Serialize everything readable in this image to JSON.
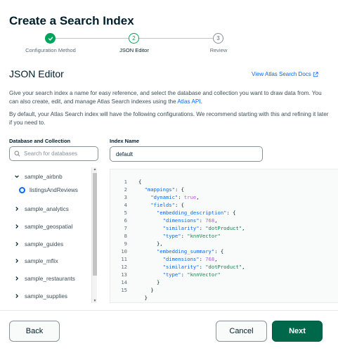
{
  "page_title": "Create a Search Index",
  "stepper": {
    "steps": [
      {
        "number": "1",
        "label": "Configuration Method",
        "state": "done"
      },
      {
        "number": "2",
        "label": "JSON Editor",
        "state": "current"
      },
      {
        "number": "3",
        "label": "Review",
        "state": "todo"
      }
    ]
  },
  "section_title": "JSON Editor",
  "docs_link": "View Atlas Search Docs",
  "description": {
    "p1_text": "Give your search index a name for easy reference, and select the database and collection you want to draw data from. You can also create, edit, and manage Atlas Search indexes using the ",
    "p1_link": "Atlas API",
    "p1_end": ".",
    "p2": "By default, your Atlas Search index will have the following configurations. We recommend starting with this and refining it later if you need to."
  },
  "db_panel": {
    "label": "Database and Collection",
    "search_placeholder": "Search for databases",
    "databases": [
      {
        "name": "sample_airbnb",
        "expanded": true,
        "collections": [
          "listingsAndReviews"
        ]
      },
      {
        "name": "sample_analytics",
        "expanded": false
      },
      {
        "name": "sample_geospatial",
        "expanded": false
      },
      {
        "name": "sample_guides",
        "expanded": false
      },
      {
        "name": "sample_mflix",
        "expanded": false
      },
      {
        "name": "sample_restaurants",
        "expanded": false
      },
      {
        "name": "sample_supplies",
        "expanded": false
      }
    ]
  },
  "index_name": {
    "label": "Index Name",
    "value": "default"
  },
  "editor": {
    "line_numbers": [
      "1",
      "2",
      "3",
      "4",
      "5",
      "6",
      "7",
      "8",
      "9",
      "10",
      "11",
      "12",
      "13",
      "14",
      "15"
    ]
  },
  "buttons": {
    "back": "Back",
    "cancel": "Cancel",
    "next": "Next"
  },
  "colors": {
    "primary": "#00684a",
    "success": "#00a35c",
    "link": "#016bf8"
  }
}
